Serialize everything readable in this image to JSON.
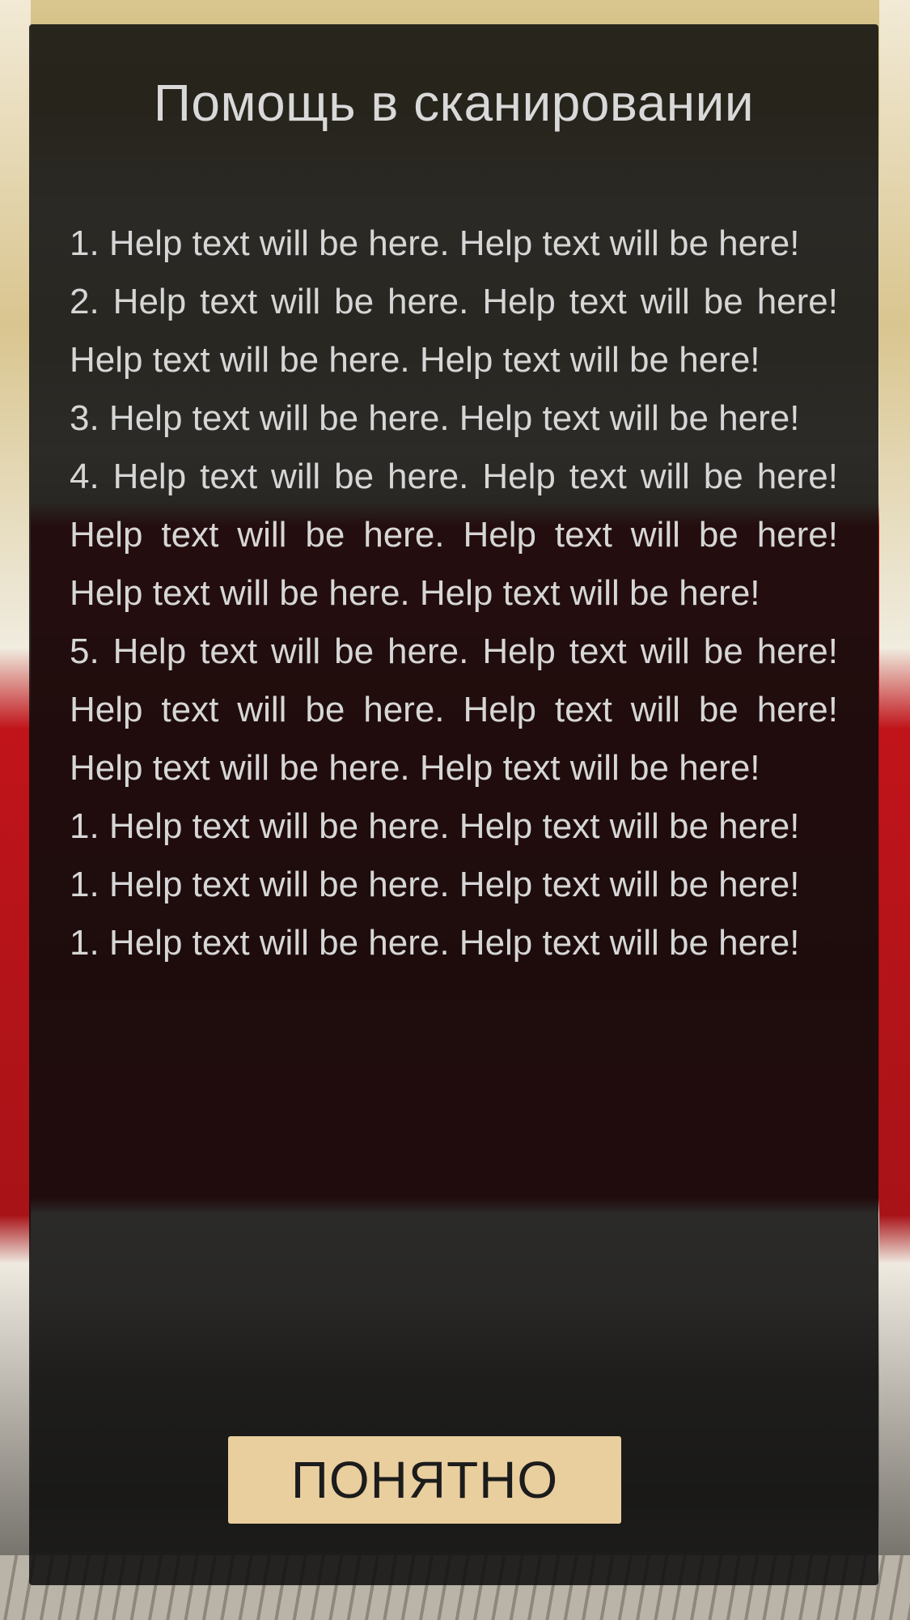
{
  "dialog": {
    "title": "Помощь в сканировании",
    "items": [
      "1. Help text will be here. Help text will be here!",
      "2. Help text will be here. Help text will be here! Help text will be here. Help text will be here!",
      "3. Help text will be here. Help text will be here!",
      "4. Help text will be here. Help text will be here! Help text will be here. Help text will be here! Help text will be here. Help text will be here!",
      "5. Help text will be here. Help text will be here! Help text will be here. Help text will be here! Help text will be here. Help text will be here!",
      "1. Help text will be here. Help text will be here!",
      "1. Help text will be here. Help text will be here!",
      "1. Help text will be here. Help text will be here!"
    ],
    "button_label": "ПОНЯТНО"
  },
  "colors": {
    "overlay": "#0c0c0c",
    "text": "#d6d6d6",
    "button_background": "#e9cf9e",
    "button_text": "#1c1c1c"
  }
}
